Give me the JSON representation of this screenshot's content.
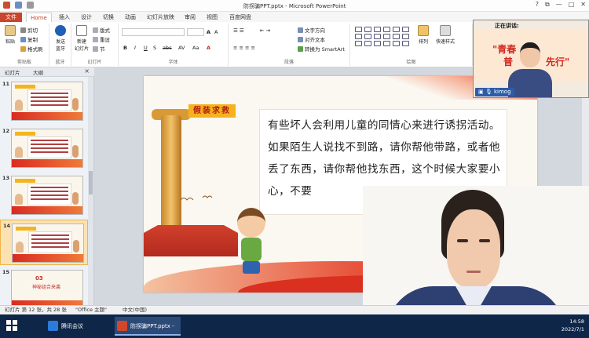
{
  "window": {
    "title": "防拐骗PPT.pptx - Microsoft PowerPoint"
  },
  "ribbon_tabs": [
    {
      "label": "文件"
    },
    {
      "label": "Home"
    },
    {
      "label": "插入"
    },
    {
      "label": "设计"
    },
    {
      "label": "切换"
    },
    {
      "label": "动画"
    },
    {
      "label": "幻灯片放映"
    },
    {
      "label": "审阅"
    },
    {
      "label": "视图"
    },
    {
      "label": "百度网盘"
    }
  ],
  "ribbon": {
    "clipboard": {
      "paste": "粘贴",
      "cut": "剪切",
      "copy": "复制",
      "format_painter": "格式刷",
      "group_label": "剪贴板"
    },
    "bluetooth": {
      "label": "发送",
      "label2": "蓝牙",
      "group_label": "蓝牙"
    },
    "slides": {
      "new_slide": "新建",
      "new_slide2": "幻灯片",
      "layout": "版式",
      "reset": "重设",
      "section": "节",
      "group_label": "幻灯片"
    },
    "font": {
      "group_label": "字体"
    },
    "paragraph": {
      "text_direction": "文字方向",
      "align_text": "对齐文本",
      "smartart": "转换为 SmartArt",
      "group_label": "段落"
    },
    "drawing": {
      "arrange": "排列",
      "quick_styles": "快速样式",
      "group_label": "绘图"
    }
  },
  "pane": {
    "tab_slides": "幻灯片",
    "tab_outline": "大纲",
    "thumbnails": [
      {
        "num": "11",
        "selected": false,
        "kind": "text"
      },
      {
        "num": "12",
        "selected": false,
        "kind": "text"
      },
      {
        "num": "13",
        "selected": false,
        "kind": "text"
      },
      {
        "num": "14",
        "selected": true,
        "kind": "text"
      },
      {
        "num": "15",
        "selected": false,
        "kind": "section",
        "big": "03",
        "label": "神秘组合来袭"
      }
    ]
  },
  "slide": {
    "tag": "假装求救",
    "paragraph": "有些坏人会利用儿童的同情心来进行诱拐活动。如果陌生人说找不到路，请你帮他带路，或者他丢了东西，请你帮他找东西，这个时候大家要小心，不要"
  },
  "meeting": {
    "speaking_label": "正在讲话:",
    "poster_line1": "\"青春",
    "poster_line2": "普",
    "poster_line3": "先行\"",
    "participant_name": "kimog"
  },
  "status_bar": {
    "slide_info": "幻灯片 第 12 张，共 28 张",
    "theme": "\"Office 主题\"",
    "language": "中文(中国)"
  },
  "taskbar": {
    "app1": "腾讯会议",
    "app2": "防拐骗PPT.pptx - ...",
    "time": "14:58",
    "date": "2022/7/1"
  },
  "colors": {
    "accent": "#c8442a",
    "slide_red": "#d9301f",
    "tag_yellow": "#f6b21e",
    "taskbar": "#0e2648",
    "selected_thumb": "#fbe2b0"
  },
  "icons": {
    "paste": "clipboard-icon",
    "bluetooth": "bluetooth-icon",
    "mic": "microphone-icon",
    "user": "user-icon"
  }
}
